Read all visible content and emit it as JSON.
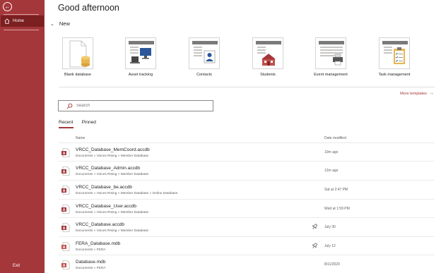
{
  "sidebar": {
    "home_label": "Home",
    "exit_label": "Exit"
  },
  "main": {
    "greeting": "Good afternoon",
    "new_section": "New",
    "templates": [
      {
        "label": "Blank database",
        "icon": "blank-database-icon"
      },
      {
        "label": "Asset tracking",
        "icon": "asset-tracking-icon"
      },
      {
        "label": "Contacts",
        "icon": "contacts-icon"
      },
      {
        "label": "Students",
        "icon": "students-icon"
      },
      {
        "label": "Event management",
        "icon": "event-management-icon"
      },
      {
        "label": "Task management",
        "icon": "task-management-icon"
      }
    ],
    "more_templates": "More templates",
    "search_placeholder": "Search",
    "tabs": {
      "recent": "Recent",
      "pinned": "Pinned"
    },
    "columns": {
      "name": "Name",
      "date": "Date modified"
    },
    "files": [
      {
        "name": "VRCC_Database_MemCoord.accdb",
        "path": "Documents » Voices Rising » Member Database",
        "date": "10m ago",
        "pinned": false,
        "type": "accdb"
      },
      {
        "name": "VRCC_Database_Admin.accdb",
        "path": "Documents » Voices Rising » Member Database",
        "date": "12m ago",
        "pinned": false,
        "type": "accdb"
      },
      {
        "name": "VRCC_Database_be.accdb",
        "path": "Documents » Voices Rising » Member Database » Online Database",
        "date": "Sat at 2:47 PM",
        "pinned": false,
        "type": "accdb"
      },
      {
        "name": "VRCC_Database_User.accdb",
        "path": "Documents » Voices Rising » Member Database",
        "date": "Wed at 1:59 PM",
        "pinned": false,
        "type": "accdb"
      },
      {
        "name": "VRCC_Database.accdb",
        "path": "Documents » Voices Rising » Member Database",
        "date": "July 30",
        "pinned": true,
        "type": "accdb"
      },
      {
        "name": "FERA_Database.mdb",
        "path": "Documents » FERA",
        "date": "July 12",
        "pinned": true,
        "type": "mdb"
      },
      {
        "name": "Database.mdb",
        "path": "Documents » FERA",
        "date": "8/11/2020",
        "pinned": false,
        "type": "mdb"
      }
    ]
  },
  "colors": {
    "accent": "#a4373a",
    "accent_dark": "#7b1f21"
  }
}
